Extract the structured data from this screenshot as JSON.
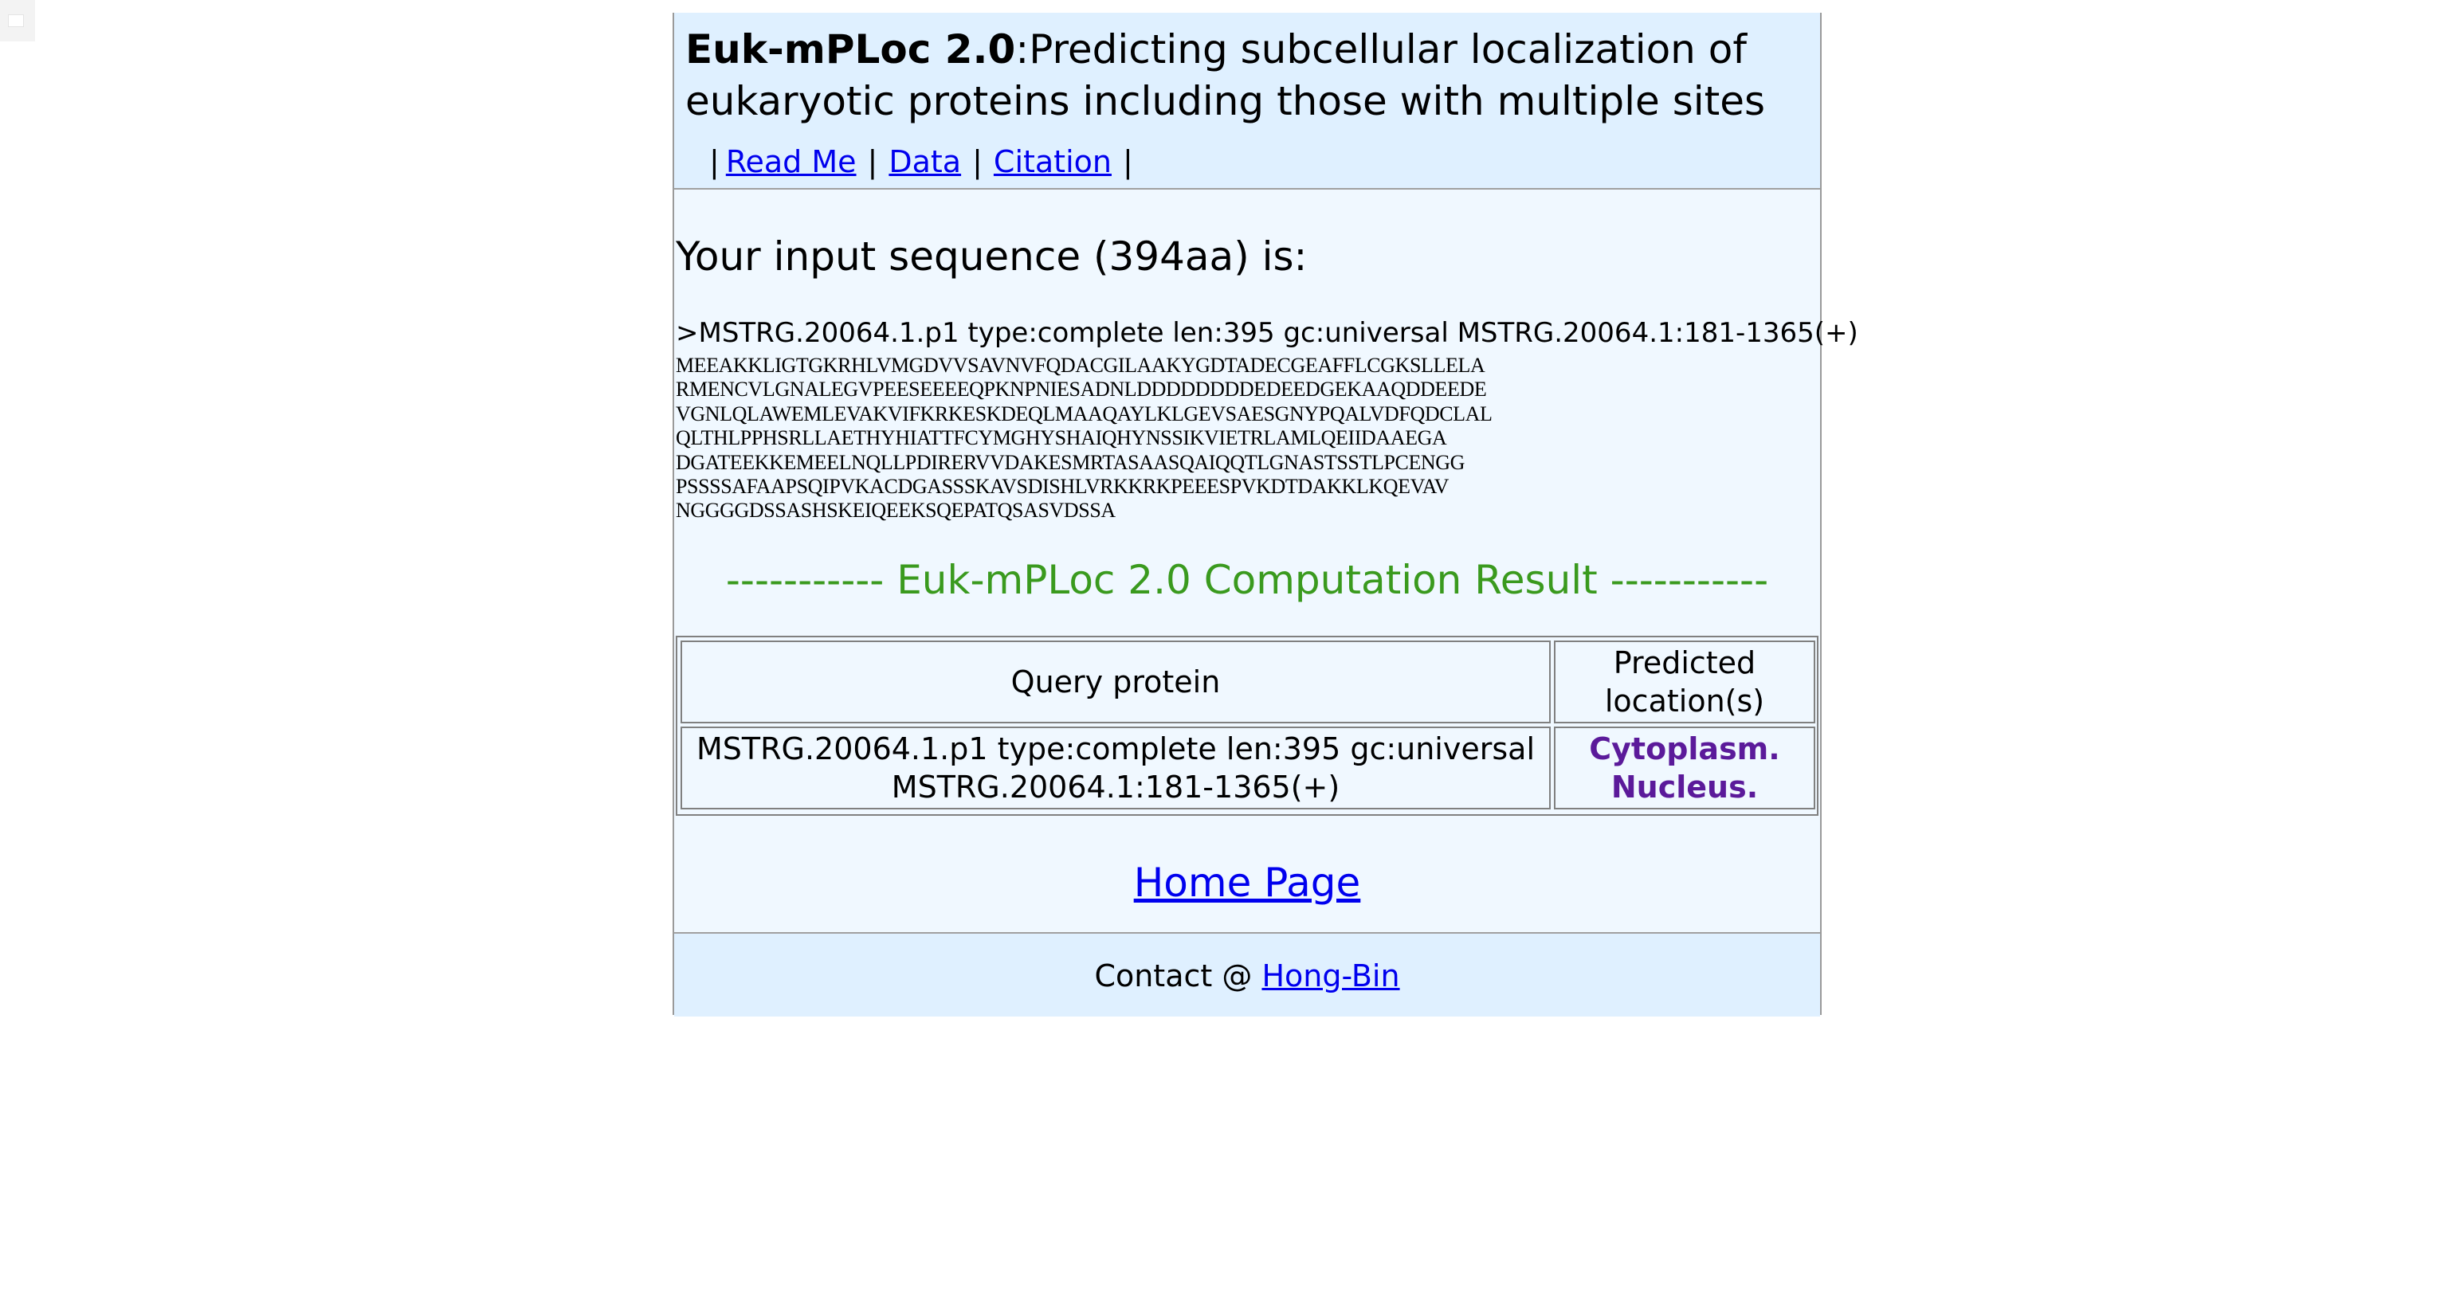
{
  "header": {
    "title_bold": "Euk-mPLoc 2.0",
    "title_rest": ":Predicting subcellular localization of eukaryotic proteins including those with multiple sites",
    "nav": {
      "separator": "|",
      "items": [
        {
          "label": "Read Me"
        },
        {
          "label": "Data"
        },
        {
          "label": "Citation"
        }
      ]
    }
  },
  "input": {
    "heading": "Your input sequence (394aa) is:",
    "fasta_header": ">MSTRG.20064.1.p1 type:complete len:395 gc:universal MSTRG.20064.1:181-1365(+)",
    "sequence_lines": [
      "MEEAKKLIGTGKRHLVMGDVVSAVNVFQDACGILAAKYGDTADECGEAFFLCGKSLLELA",
      "RMENCVLGNALEGVPEESEEEEQPKNPNIESADNLDDDDDDDDEDEEDGEKAAQDDEEDE",
      "VGNLQLAWEMLEVAKVIFKRKESKDEQLMAAQAYLKLGEVSAESGNYPQALVDFQDCLAL",
      "QLTHLPPHSRLLAETHYHIATTFCYMGHYSHAIQHYNSSIKVIETRLAMLQEIIDAAEGA",
      "DGATEEKKEMEELNQLLPDIRERVVDAKESMRTASAASQAIQQTLGNASTSSTLPCENGG",
      "PSSSSAFAAPSQIPVKACDGASSSKAVSDISHLVRKKRKPEEESPVKDTDAKKLKQEVAV",
      "NGGGGDSSASHSKEIQEEKSQEPATQSASVDSSA"
    ]
  },
  "result": {
    "heading": "----------- Euk-mPLoc 2.0 Computation Result -----------",
    "table": {
      "headers": [
        "Query protein",
        "Predicted location(s)"
      ],
      "rows": [
        {
          "query": "MSTRG.20064.1.p1 type:complete len:395 gc:universal MSTRG.20064.1:181-1365(+)",
          "locations": [
            "Cytoplasm.",
            "Nucleus."
          ]
        }
      ]
    }
  },
  "home_link": "Home Page",
  "footer": {
    "contact_prefix": "Contact @ ",
    "contact_link": "Hong-Bin"
  },
  "colors": {
    "header_bg": "#dff0ff",
    "body_bg": "#f0f8ff",
    "link": "#0000ee",
    "result_heading": "#3a9a1e",
    "location_text": "#5b1a9a"
  }
}
